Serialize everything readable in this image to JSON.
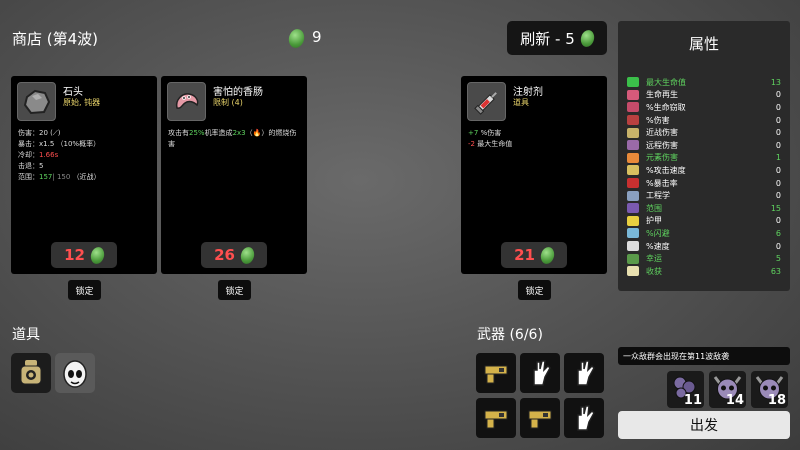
{
  "header": {
    "shop_title": "商店 (第4波)",
    "materials": "9",
    "reroll_label": "刷新 - 5"
  },
  "cards": [
    {
      "name": "石头",
      "subtitle": "原始, 钝器",
      "stats": [
        {
          "label": "伤害：",
          "value": "20",
          "extra": "(⟋)"
        },
        {
          "label": "暴击：",
          "value": "x1.5",
          "extra": "（10%概率）"
        },
        {
          "label": "冷却：",
          "value": "1.66s"
        },
        {
          "label": "击退：",
          "value": "5"
        },
        {
          "label": "范围：",
          "value": "157",
          "dim": "| 150",
          "extra": "（近战）"
        }
      ],
      "price": "12",
      "lock_label": "锁定",
      "icon": "rock-icon"
    },
    {
      "name": "害怕的香肠",
      "subtitle": "限制 (4)",
      "desc_pre": "攻击有",
      "desc_pct": "25%",
      "desc_mid": "机率造成",
      "desc_dmg": "2x3",
      "desc_post": "（🔥）的燃烧伤害",
      "price": "26",
      "lock_label": "锁定",
      "icon": "sausage-icon"
    },
    {
      "name": "注射剂",
      "subtitle": "道具",
      "effects": [
        {
          "value": "+7",
          "label": "%伤害",
          "color": "#5fd35f"
        },
        {
          "value": "-2",
          "label": "最大生命值",
          "color": "#ff4f4f"
        }
      ],
      "price": "21",
      "lock_label": "锁定",
      "icon": "syringe-icon"
    }
  ],
  "items_section": {
    "title": "道具"
  },
  "weapons_section": {
    "title": "武器 (6/6)"
  },
  "stats_panel": {
    "title": "属性",
    "rows": [
      {
        "label": "最大生命值",
        "value": "13",
        "highlight": true,
        "icon_color": "#3bbf4a"
      },
      {
        "label": "生命再生",
        "value": "0",
        "highlight": false,
        "icon_color": "#d55a7a"
      },
      {
        "label": "%生命窃取",
        "value": "0",
        "highlight": false,
        "icon_color": "#c54b6a"
      },
      {
        "label": "%伤害",
        "value": "0",
        "highlight": false,
        "icon_color": "#b84040"
      },
      {
        "label": "近战伤害",
        "value": "0",
        "highlight": false,
        "icon_color": "#c8b36a"
      },
      {
        "label": "远程伤害",
        "value": "0",
        "highlight": false,
        "icon_color": "#9a6aa8"
      },
      {
        "label": "元素伤害",
        "value": "1",
        "highlight": true,
        "icon_color": "#e88a3a"
      },
      {
        "label": "%攻击速度",
        "value": "0",
        "highlight": false,
        "icon_color": "#d8c060"
      },
      {
        "label": "%暴击率",
        "value": "0",
        "highlight": false,
        "icon_color": "#c83030"
      },
      {
        "label": "工程学",
        "value": "0",
        "highlight": false,
        "icon_color": "#8aa0c0"
      },
      {
        "label": "范围",
        "value": "15",
        "highlight": true,
        "icon_color": "#7a5ab0"
      },
      {
        "label": "护甲",
        "value": "0",
        "highlight": false,
        "icon_color": "#e8d040"
      },
      {
        "label": "%闪避",
        "value": "6",
        "highlight": true,
        "icon_color": "#7ab8d8"
      },
      {
        "label": "%速度",
        "value": "0",
        "highlight": false,
        "icon_color": "#dddddd"
      },
      {
        "label": "幸运",
        "value": "5",
        "highlight": true,
        "icon_color": "#5a9a4a"
      },
      {
        "label": "收获",
        "value": "63",
        "highlight": true,
        "icon_color": "#e8e0b0"
      }
    ]
  },
  "wave_info": {
    "banner": "一众敌群会出现在第11波敌袭",
    "enemies": [
      {
        "count": "11",
        "icon": "crab-swarm-icon"
      },
      {
        "count": "14",
        "icon": "horned-skull-icon"
      },
      {
        "count": "18",
        "icon": "horned-skull-icon"
      }
    ]
  },
  "go_label": "出发",
  "colors": {
    "highlight": "#5fd35f",
    "price": "#ff4f4f",
    "material": "#4a9a3a"
  }
}
